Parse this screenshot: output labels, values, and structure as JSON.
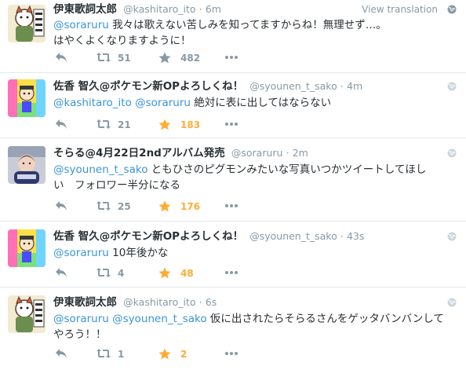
{
  "colors": {
    "link": "#3b94d9",
    "muted": "#8899a6",
    "favorite_active": "#ffac33",
    "divider": "#e1e8ed"
  },
  "tweets": [
    {
      "name": "伊東歌詞太郎",
      "handle": "@kashitaro_ito",
      "sep": "·",
      "time": "6m",
      "view_translation": "View translation",
      "mentions": [
        "@soraruru"
      ],
      "text_line1": "我々は歌えない苦しみを知ってますからね！無理せず…。",
      "text_line2": "はやくよくなりますように！",
      "retweets": "51",
      "favorites": "482",
      "favorited": false,
      "avatar": "cat-illustration-avatar"
    },
    {
      "name": "佐香 智久@ポケモン新OPよろしくね！",
      "handle": "@syounen_t_sako",
      "sep": "·",
      "time": "4m",
      "mentions": [
        "@kashitaro_ito",
        "@soraruru"
      ],
      "text_line1": "絶対に表に出してはならない",
      "retweets": "21",
      "favorites": "183",
      "favorited": true,
      "avatar": "colorful-character-avatar"
    },
    {
      "name": "そらる@4月22日2ndアルバム発売",
      "handle": "@soraruru",
      "sep": "·",
      "time": "2m",
      "mentions": [
        "@syounen_t_sako"
      ],
      "text_line1": "ともひさのピグモンみたいな写真いつかツイートしてほし",
      "text_line2": "い　フォロワー半分になる",
      "retweets": "25",
      "favorites": "176",
      "favorited": true,
      "avatar": "baby-photo-avatar"
    },
    {
      "name": "佐香 智久@ポケモン新OPよろしくね！",
      "handle": "@syounen_t_sako",
      "sep": "·",
      "time": "43s",
      "mentions": [
        "@soraruru"
      ],
      "text_line1": "10年後かな",
      "retweets": "4",
      "favorites": "48",
      "favorited": true,
      "avatar": "colorful-character-avatar"
    },
    {
      "name": "伊東歌詞太郎",
      "handle": "@kashitaro_ito",
      "sep": "·",
      "time": "6s",
      "mentions": [
        "@soraruru",
        "@syounen_t_sako"
      ],
      "text_line1": "仮に出されたらそらるさんをゲッタバンバンして",
      "text_line2": "やろう！！",
      "retweets": "1",
      "favorites": "2",
      "favorited": true,
      "avatar": "cat-illustration-avatar"
    }
  ]
}
